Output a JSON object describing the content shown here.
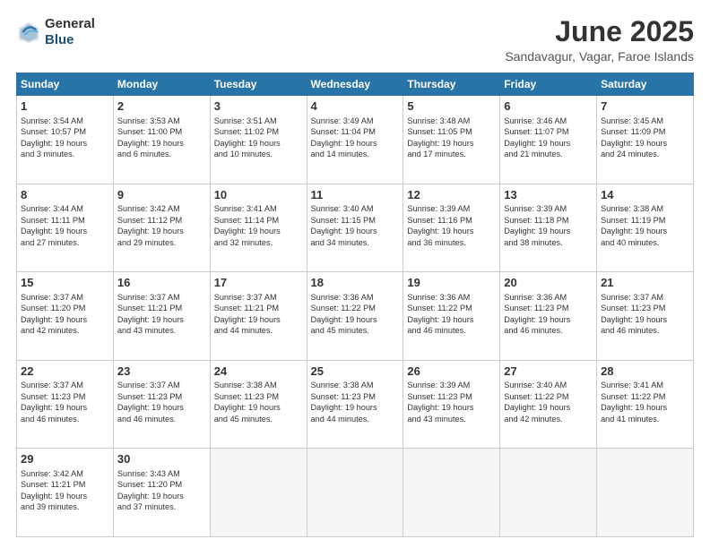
{
  "header": {
    "logo_general": "General",
    "logo_blue": "Blue",
    "month_title": "June 2025",
    "location": "Sandavagur, Vagar, Faroe Islands"
  },
  "days_of_week": [
    "Sunday",
    "Monday",
    "Tuesday",
    "Wednesday",
    "Thursday",
    "Friday",
    "Saturday"
  ],
  "weeks": [
    [
      {
        "day": "1",
        "text": "Sunrise: 3:54 AM\nSunset: 10:57 PM\nDaylight: 19 hours\nand 3 minutes."
      },
      {
        "day": "2",
        "text": "Sunrise: 3:53 AM\nSunset: 11:00 PM\nDaylight: 19 hours\nand 6 minutes."
      },
      {
        "day": "3",
        "text": "Sunrise: 3:51 AM\nSunset: 11:02 PM\nDaylight: 19 hours\nand 10 minutes."
      },
      {
        "day": "4",
        "text": "Sunrise: 3:49 AM\nSunset: 11:04 PM\nDaylight: 19 hours\nand 14 minutes."
      },
      {
        "day": "5",
        "text": "Sunrise: 3:48 AM\nSunset: 11:05 PM\nDaylight: 19 hours\nand 17 minutes."
      },
      {
        "day": "6",
        "text": "Sunrise: 3:46 AM\nSunset: 11:07 PM\nDaylight: 19 hours\nand 21 minutes."
      },
      {
        "day": "7",
        "text": "Sunrise: 3:45 AM\nSunset: 11:09 PM\nDaylight: 19 hours\nand 24 minutes."
      }
    ],
    [
      {
        "day": "8",
        "text": "Sunrise: 3:44 AM\nSunset: 11:11 PM\nDaylight: 19 hours\nand 27 minutes."
      },
      {
        "day": "9",
        "text": "Sunrise: 3:42 AM\nSunset: 11:12 PM\nDaylight: 19 hours\nand 29 minutes."
      },
      {
        "day": "10",
        "text": "Sunrise: 3:41 AM\nSunset: 11:14 PM\nDaylight: 19 hours\nand 32 minutes."
      },
      {
        "day": "11",
        "text": "Sunrise: 3:40 AM\nSunset: 11:15 PM\nDaylight: 19 hours\nand 34 minutes."
      },
      {
        "day": "12",
        "text": "Sunrise: 3:39 AM\nSunset: 11:16 PM\nDaylight: 19 hours\nand 36 minutes."
      },
      {
        "day": "13",
        "text": "Sunrise: 3:39 AM\nSunset: 11:18 PM\nDaylight: 19 hours\nand 38 minutes."
      },
      {
        "day": "14",
        "text": "Sunrise: 3:38 AM\nSunset: 11:19 PM\nDaylight: 19 hours\nand 40 minutes."
      }
    ],
    [
      {
        "day": "15",
        "text": "Sunrise: 3:37 AM\nSunset: 11:20 PM\nDaylight: 19 hours\nand 42 minutes."
      },
      {
        "day": "16",
        "text": "Sunrise: 3:37 AM\nSunset: 11:21 PM\nDaylight: 19 hours\nand 43 minutes."
      },
      {
        "day": "17",
        "text": "Sunrise: 3:37 AM\nSunset: 11:21 PM\nDaylight: 19 hours\nand 44 minutes."
      },
      {
        "day": "18",
        "text": "Sunrise: 3:36 AM\nSunset: 11:22 PM\nDaylight: 19 hours\nand 45 minutes."
      },
      {
        "day": "19",
        "text": "Sunrise: 3:36 AM\nSunset: 11:22 PM\nDaylight: 19 hours\nand 46 minutes."
      },
      {
        "day": "20",
        "text": "Sunrise: 3:36 AM\nSunset: 11:23 PM\nDaylight: 19 hours\nand 46 minutes."
      },
      {
        "day": "21",
        "text": "Sunrise: 3:37 AM\nSunset: 11:23 PM\nDaylight: 19 hours\nand 46 minutes."
      }
    ],
    [
      {
        "day": "22",
        "text": "Sunrise: 3:37 AM\nSunset: 11:23 PM\nDaylight: 19 hours\nand 46 minutes."
      },
      {
        "day": "23",
        "text": "Sunrise: 3:37 AM\nSunset: 11:23 PM\nDaylight: 19 hours\nand 46 minutes."
      },
      {
        "day": "24",
        "text": "Sunrise: 3:38 AM\nSunset: 11:23 PM\nDaylight: 19 hours\nand 45 minutes."
      },
      {
        "day": "25",
        "text": "Sunrise: 3:38 AM\nSunset: 11:23 PM\nDaylight: 19 hours\nand 44 minutes."
      },
      {
        "day": "26",
        "text": "Sunrise: 3:39 AM\nSunset: 11:23 PM\nDaylight: 19 hours\nand 43 minutes."
      },
      {
        "day": "27",
        "text": "Sunrise: 3:40 AM\nSunset: 11:22 PM\nDaylight: 19 hours\nand 42 minutes."
      },
      {
        "day": "28",
        "text": "Sunrise: 3:41 AM\nSunset: 11:22 PM\nDaylight: 19 hours\nand 41 minutes."
      }
    ],
    [
      {
        "day": "29",
        "text": "Sunrise: 3:42 AM\nSunset: 11:21 PM\nDaylight: 19 hours\nand 39 minutes."
      },
      {
        "day": "30",
        "text": "Sunrise: 3:43 AM\nSunset: 11:20 PM\nDaylight: 19 hours\nand 37 minutes."
      },
      {
        "day": "",
        "text": ""
      },
      {
        "day": "",
        "text": ""
      },
      {
        "day": "",
        "text": ""
      },
      {
        "day": "",
        "text": ""
      },
      {
        "day": "",
        "text": ""
      }
    ]
  ]
}
